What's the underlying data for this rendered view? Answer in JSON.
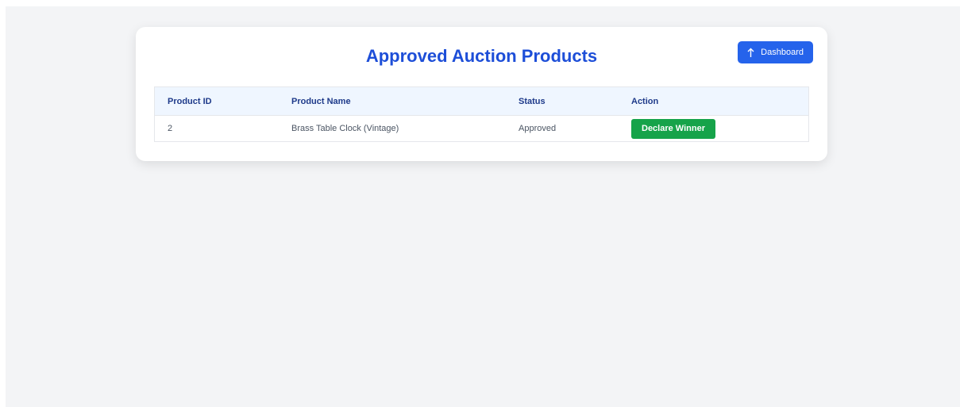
{
  "page": {
    "title": "Approved Auction Products",
    "dashboard_button": {
      "label": "Dashboard",
      "icon": "arrow-up-icon"
    }
  },
  "table": {
    "headers": [
      "Product ID",
      "Product Name",
      "Status",
      "Action"
    ],
    "rows": [
      {
        "id": "2",
        "name": "Brass Table Clock (Vintage)",
        "status": "Approved",
        "action_label": "Declare Winner"
      }
    ]
  },
  "colors": {
    "page_background": "#f3f4f6",
    "title": "#1d4ed8",
    "primary_button": "#2563eb",
    "success_button": "#16a34a",
    "table_header_bg": "#eff6ff",
    "table_header_text": "#1e3a8a"
  }
}
